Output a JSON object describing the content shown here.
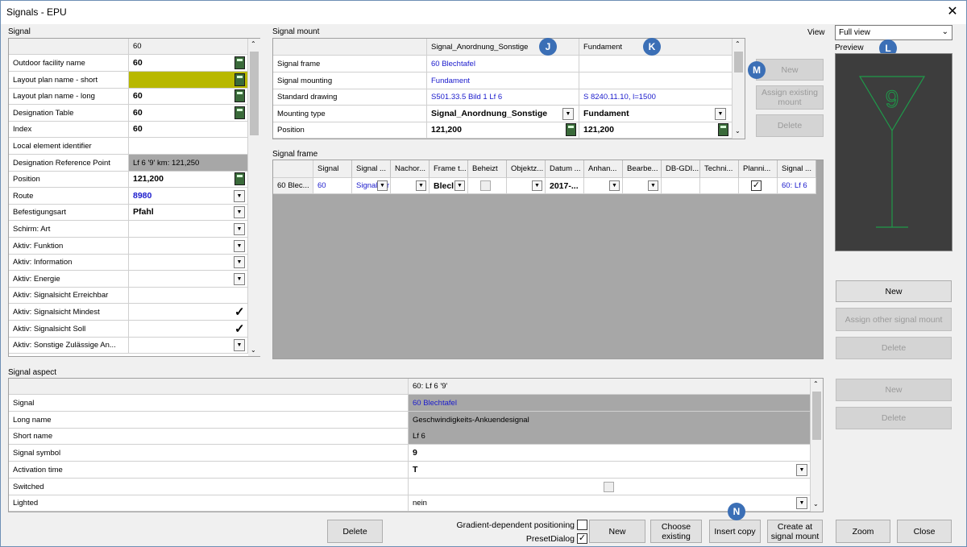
{
  "window": {
    "title": "Signals - EPU",
    "close_glyph": "✕"
  },
  "signal": {
    "section_label": "Signal",
    "column_header": "60",
    "rows": [
      {
        "label": "Outdoor facility name",
        "value": "60"
      },
      {
        "label": "Layout plan name - short",
        "value": ""
      },
      {
        "label": "Layout plan name - long",
        "value": "60"
      },
      {
        "label": "Designation Table",
        "value": "60"
      },
      {
        "label": "Index",
        "value": "60"
      },
      {
        "label": "Local element identifier",
        "value": ""
      },
      {
        "label": "Designation Reference Point",
        "value": "Lf 6 '9' km: 121,250"
      },
      {
        "label": "Position",
        "value": "121,200"
      },
      {
        "label": "Route",
        "value": "8980"
      },
      {
        "label": "Befestigungsart",
        "value": "Pfahl"
      },
      {
        "label": "Schirm: Art",
        "value": ""
      },
      {
        "label": "Aktiv: Funktion",
        "value": ""
      },
      {
        "label": "Aktiv: Information",
        "value": ""
      },
      {
        "label": "Aktiv: Energie",
        "value": ""
      },
      {
        "label": "Aktiv: Signalsicht Erreichbar",
        "value": ""
      },
      {
        "label": "Aktiv: Signalsicht Mindest",
        "value": "✓"
      },
      {
        "label": "Aktiv: Signalsicht Soll",
        "value": "✓"
      },
      {
        "label": "Aktiv: Sonstige Zulässige An...",
        "value": ""
      }
    ]
  },
  "signal_mount": {
    "section_label": "Signal mount",
    "headers": [
      "Signal_Anordnung_Sonstige",
      "Fundament"
    ],
    "rows": [
      {
        "label": "Signal frame",
        "v1": "60 Blechtafel",
        "v2": ""
      },
      {
        "label": "Signal mounting",
        "v1": "Fundament",
        "v2": ""
      },
      {
        "label": "Standard drawing",
        "v1": "S501.33.5 Bild 1 Lf 6",
        "v2": "S 8240.11.10, l=1500"
      },
      {
        "label": "Mounting type",
        "v1": "Signal_Anordnung_Sonstige",
        "v2": "Fundament"
      },
      {
        "label": "Position",
        "v1": "121,200",
        "v2": "121,200"
      }
    ],
    "btn_new": "New",
    "btn_assign": "Assign existing mount",
    "btn_delete": "Delete"
  },
  "signal_frame": {
    "section_label": "Signal frame",
    "headers": [
      "Signal",
      "Signal ...",
      "Nachor...",
      "Frame t...",
      "Beheizt",
      "Objektz...",
      "Datum ...",
      "Anhan...",
      "Bearbe...",
      "DB-GDI...",
      "Techni...",
      "Planni...",
      "Signal ..."
    ],
    "row": {
      "name": "60 Blec...",
      "signal": "60",
      "signal2": "Signal_Ar",
      "frame": "Blecl",
      "datum": "2017-...",
      "last": "60: Lf 6"
    }
  },
  "view": {
    "label": "View",
    "selected": "Full view",
    "preview_label": "Preview"
  },
  "right_buttons": {
    "new1": "New",
    "assign_other": "Assign other signal mount",
    "delete1": "Delete",
    "new2": "New",
    "delete2": "Delete"
  },
  "signal_aspect": {
    "section_label": "Signal aspect",
    "column_header": "60: Lf 6 '9'",
    "rows": [
      {
        "label": "Signal",
        "value": "60 Blechtafel"
      },
      {
        "label": "Long name",
        "value": "Geschwindigkeits-Ankuendesignal"
      },
      {
        "label": "Short name",
        "value": "Lf 6"
      },
      {
        "label": "Signal symbol",
        "value": "9"
      },
      {
        "label": "Activation time",
        "value": "T"
      },
      {
        "label": "Switched",
        "value": ""
      },
      {
        "label": "Lighted",
        "value": "nein"
      }
    ]
  },
  "bottom": {
    "delete": "Delete",
    "gradient": "Gradient-dependent positioning",
    "preset": "PresetDialog",
    "new": "New",
    "choose": "Choose existing",
    "insert": "Insert copy",
    "create": "Create at signal mount",
    "zoom": "Zoom",
    "close": "Close"
  },
  "badges": {
    "J": "J",
    "K": "K",
    "L": "L",
    "M": "M",
    "N": "N"
  },
  "colors": {
    "accent": "#3b6fb6",
    "highlight": "#b8b800",
    "disabled_gray": "#a7a7a7",
    "preview_bg": "#3d3d3d",
    "preview_line": "#1f9a4a"
  }
}
